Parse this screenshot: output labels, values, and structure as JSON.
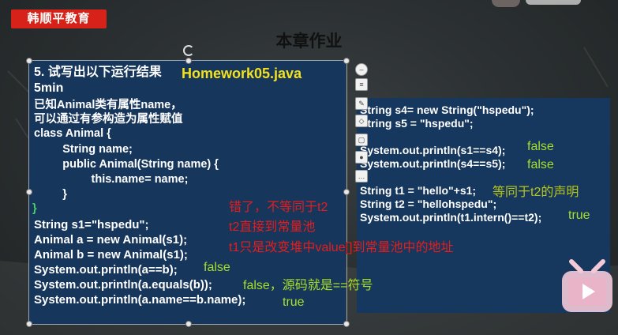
{
  "brand": {
    "logo_text": "韩顺平教育"
  },
  "page_title": "本章作业",
  "left_panel": {
    "heading": "5. 试写出以下运行结果",
    "filename": "Homework05.java",
    "time": "5min",
    "lines": [
      "已知Animal类有属性name，",
      "可以通过有参构造为属性赋值",
      "class Animal {",
      "         String name;",
      "         public Animal(String name) {",
      "                  this.name= name;",
      "         }",
      "}",
      "String s1=\"hspedu\";",
      "Animal a = new Animal(s1);",
      "Animal b = new Animal(s1);",
      "System.out.println(a==b);",
      "System.out.println(a.equals(b));",
      "System.out.println(a.name==b.name);"
    ]
  },
  "right_panel": {
    "lines": [
      "String s4= new String(\"hspedu\");",
      "String s5 = \"hspedu\";",
      "",
      "System.out.println(s1==s4);",
      "System.out.println(s4==s5);",
      "",
      "String t1 = \"hello\"+s1;",
      "String t2 = \"hellohspedu\";",
      "System.out.println(t1.intern()==t2);"
    ]
  },
  "annotations": {
    "red_1": "错了，不等同于t2",
    "red_2": "t2直接到常量池",
    "red_3": "t1只是改变堆中value[]到常量池中的地址",
    "ans_ab": "false",
    "ans_equals": "false，源码就是==符号",
    "ans_name": "true",
    "ans_s1s4": "false",
    "ans_s4s5": "false",
    "note_t1": "等同于t2的声明",
    "ans_intern": "true"
  },
  "toolbar": {
    "icons": [
      "minus-circle-icon",
      "layers-icon",
      "pen-icon",
      "eraser-icon",
      "crop-icon",
      "pin-icon",
      "more-icon"
    ]
  },
  "colors": {
    "brand_red": "#d62218",
    "panel_blue": "#17365c",
    "highlight_yellow": "#f3e11d",
    "annotation_red": "#e41d1d",
    "annotation_green": "#a7e02a"
  }
}
